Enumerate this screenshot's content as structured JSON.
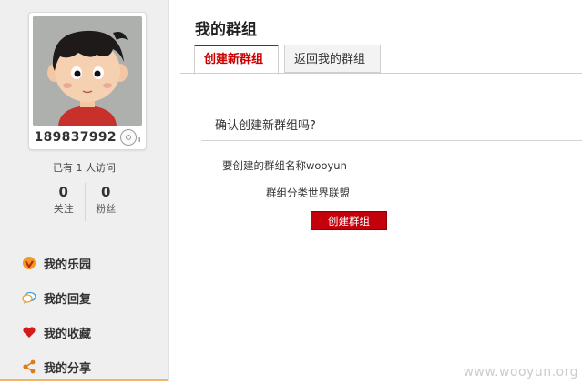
{
  "profile": {
    "username": "189837992",
    "visits_text": "已有 1 人访问",
    "stats": [
      {
        "count": "0",
        "label": "关注"
      },
      {
        "count": "0",
        "label": "粉丝"
      }
    ]
  },
  "nav": {
    "items": [
      {
        "label": "我的乐园",
        "icon": "badge-icon"
      },
      {
        "label": "我的回复",
        "icon": "speech-bubble-icon"
      },
      {
        "label": "我的收藏",
        "icon": "heart-icon"
      },
      {
        "label": "我的分享",
        "icon": "share-icon"
      }
    ]
  },
  "main": {
    "title": "我的群组",
    "tabs": [
      {
        "label": "创建新群组",
        "active": true
      },
      {
        "label": "返回我的群组",
        "active": false
      }
    ],
    "confirm_text": "确认创建新群组吗?",
    "group_name_line": "要创建的群组名称wooyun",
    "group_category_line": "群组分类世界联盟",
    "submit_label": "创建群组"
  },
  "watermark": "www.wooyun.org",
  "colors": {
    "accent": "#cc0000",
    "sidebar_bg": "#efefef"
  }
}
